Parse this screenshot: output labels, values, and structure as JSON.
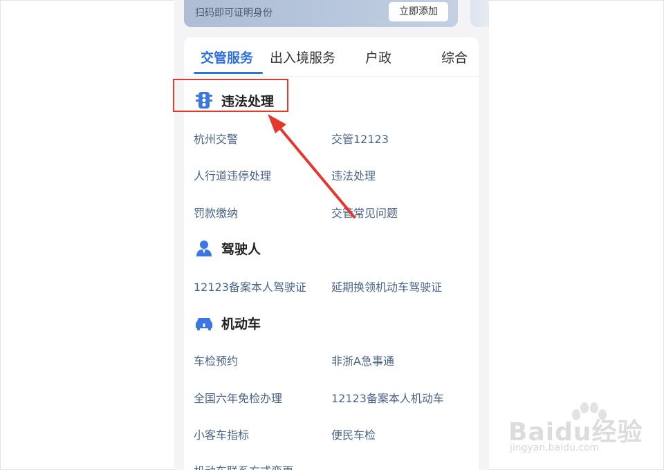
{
  "id_card": {
    "hint": "扫码即可证明身份",
    "add_button": "立即添加"
  },
  "tabs": [
    {
      "label": "交管服务",
      "active": true
    },
    {
      "label": "出入境服务",
      "active": false
    },
    {
      "label": "户政",
      "active": false
    },
    {
      "label": "综合",
      "active": false
    }
  ],
  "sections": [
    {
      "title": "违法处理",
      "icon": "traffic-light-icon",
      "links": [
        "杭州交警",
        "交管12123",
        "人行道违停处理",
        "违法处理",
        "罚款缴纳",
        "交管常见问题"
      ]
    },
    {
      "title": "驾驶人",
      "icon": "driver-person-icon",
      "links": [
        "12123备案本人驾驶证",
        "延期换领机动车驾驶证"
      ]
    },
    {
      "title": "机动车",
      "icon": "car-icon",
      "links": [
        "车检预约",
        "非浙A急事通",
        "全国六年免检办理",
        "12123备案本人机动车",
        "小客车指标",
        "便民车检",
        "机动车联系方式变更"
      ]
    }
  ],
  "annotation": {
    "highlight_color": "#e5382d"
  },
  "watermark": {
    "brand": "Baidu经验",
    "url": "jingyan.baidu.com"
  },
  "colors": {
    "accent": "#2f6fdf",
    "link": "#4a6487",
    "icon_blue": "#3a76e6"
  }
}
